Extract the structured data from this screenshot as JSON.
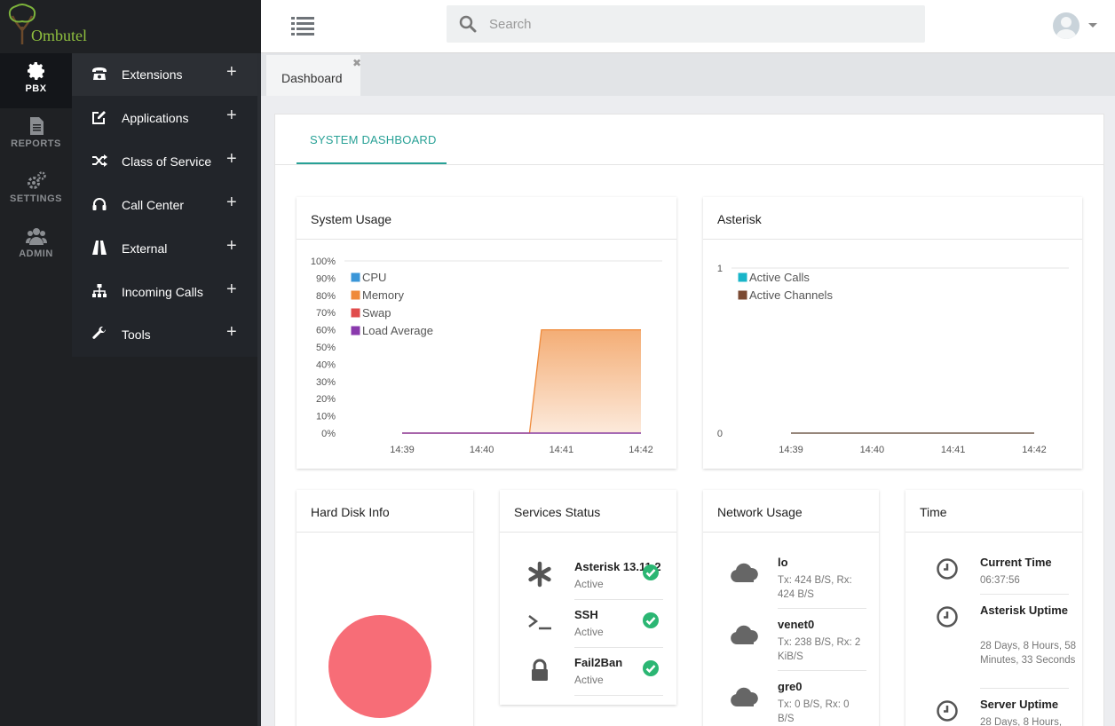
{
  "app": {
    "logo_text": "Ombutel"
  },
  "rail": {
    "items": [
      {
        "label": "PBX",
        "icon": "gear-icon",
        "active": true
      },
      {
        "label": "REPORTS",
        "icon": "document-icon"
      },
      {
        "label": "SETTINGS",
        "icon": "gears-icon"
      },
      {
        "label": "ADMIN",
        "icon": "users-icon"
      }
    ]
  },
  "submenu": {
    "items": [
      {
        "label": "Extensions",
        "icon": "phone-icon",
        "active": true
      },
      {
        "label": "Applications",
        "icon": "edit-icon"
      },
      {
        "label": "Class of Service",
        "icon": "shuffle-icon"
      },
      {
        "label": "Call Center",
        "icon": "headset-icon"
      },
      {
        "label": "External",
        "icon": "road-icon"
      },
      {
        "label": "Incoming Calls",
        "icon": "sitemap-icon"
      },
      {
        "label": "Tools",
        "icon": "wrench-icon"
      }
    ],
    "expand_symbol": "+"
  },
  "header": {
    "search_placeholder": "Search"
  },
  "tabs": [
    {
      "label": "Dashboard",
      "close": "✖"
    }
  ],
  "main": {
    "tab_label": "SYSTEM DASHBOARD"
  },
  "system_usage": {
    "title": "System Usage"
  },
  "asterisk": {
    "title": "Asterisk"
  },
  "chart_data": [
    {
      "type": "area",
      "title": "System Usage",
      "x": [
        "14:39",
        "14:40",
        "14:41",
        "14:42"
      ],
      "ylim": [
        0,
        100
      ],
      "yticks": [
        "100%",
        "90%",
        "80%",
        "70%",
        "60%",
        "50%",
        "40%",
        "30%",
        "20%",
        "10%",
        "0%"
      ],
      "legend": [
        "CPU",
        "Memory",
        "Swap",
        "Load Average"
      ],
      "colors": {
        "CPU": "#3a96d8",
        "Memory": "#ef8a3a",
        "Swap": "#e04b4b",
        "Load Average": "#8a3aad"
      },
      "series": [
        {
          "name": "CPU",
          "values": [
            0,
            0,
            0,
            0
          ]
        },
        {
          "name": "Memory",
          "points": [
            [
              0,
              0
            ],
            [
              1.6,
              0
            ],
            [
              1.75,
              60
            ],
            [
              3.0,
              60
            ]
          ]
        },
        {
          "name": "Swap",
          "values": [
            0,
            0,
            0,
            0
          ]
        },
        {
          "name": "Load Average",
          "values": [
            0,
            0,
            0,
            0
          ]
        }
      ]
    },
    {
      "type": "line",
      "title": "Asterisk",
      "x": [
        "14:39",
        "14:40",
        "14:41",
        "14:42"
      ],
      "ylim": [
        0,
        1
      ],
      "yticks": [
        "1",
        "0"
      ],
      "legend": [
        "Active Calls",
        "Active Channels"
      ],
      "colors": {
        "Active Calls": "#19b5c9",
        "Active Channels": "#7b4a33"
      },
      "series": [
        {
          "name": "Active Calls",
          "values": [
            0,
            0,
            0,
            0
          ]
        },
        {
          "name": "Active Channels",
          "values": [
            0,
            0,
            0,
            0
          ]
        }
      ]
    }
  ],
  "hard_disk": {
    "title": "Hard Disk Info",
    "pie_color": "#f76d77"
  },
  "services": {
    "title": "Services Status",
    "items": [
      {
        "name": "Asterisk 13.11.2",
        "status": "Active",
        "icon": "asterisk-icon"
      },
      {
        "name": "SSH",
        "status": "Active",
        "icon": "terminal-icon"
      },
      {
        "name": "Fail2Ban",
        "status": "Active",
        "icon": "lock-icon"
      }
    ]
  },
  "network": {
    "title": "Network Usage",
    "items": [
      {
        "name": "lo",
        "detail": "Tx: 424 B/S, Rx: 424 B/S"
      },
      {
        "name": "venet0",
        "detail": "Tx: 238 B/S, Rx: 2 KiB/S"
      },
      {
        "name": "gre0",
        "detail": "Tx: 0 B/S, Rx: 0 B/S"
      }
    ]
  },
  "time": {
    "title": "Time",
    "items": [
      {
        "name": "Current Time",
        "value": "06:37:56"
      },
      {
        "name": "Asterisk Uptime",
        "value": "28 Days, 8 Hours, 58 Minutes, 33 Seconds"
      },
      {
        "name": "Server Uptime",
        "value": "28 Days, 8 Hours,"
      }
    ]
  }
}
